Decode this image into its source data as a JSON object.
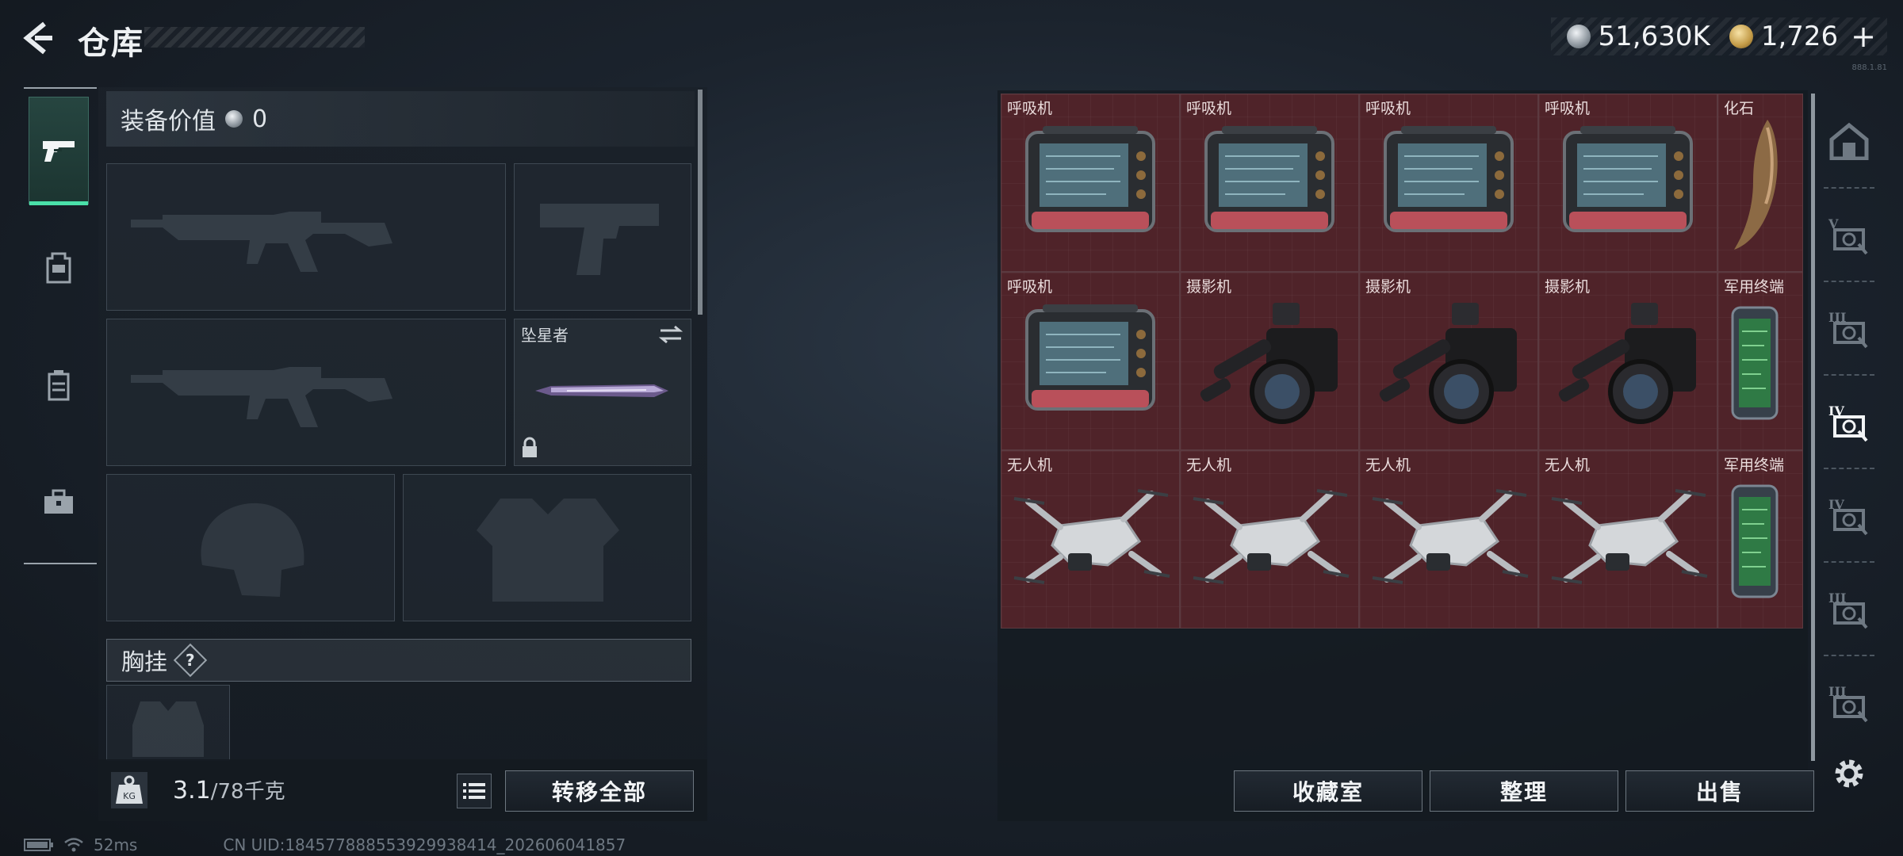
{
  "header": {
    "title": "仓库",
    "currencies": [
      {
        "icon": "silver-coin-icon",
        "value": "51,630K"
      },
      {
        "icon": "gold-coin-icon",
        "value": "1,726"
      }
    ],
    "add_symbol": "+",
    "tiny_text": "888.1.81"
  },
  "left_tabs": [
    {
      "name": "weapons",
      "icon": "pistol-icon",
      "active": true
    },
    {
      "name": "backpack",
      "icon": "backpack-icon",
      "active": false
    },
    {
      "name": "case",
      "icon": "container-icon",
      "active": false
    },
    {
      "name": "toolbox",
      "icon": "toolbox-icon",
      "active": false
    }
  ],
  "loadout": {
    "equip_value_label": "装备价值",
    "equip_value": "0",
    "melee_slot": {
      "label": "坠星者",
      "locked": true
    },
    "chest_rig_label": "胸挂",
    "help_symbol": "?",
    "weight_current": "3.1",
    "weight_max": "/78千克",
    "weight_icon_text": "KG",
    "transfer_all": "转移全部"
  },
  "stash": {
    "items": [
      {
        "name": "呼吸机",
        "icon": "ventilator"
      },
      {
        "name": "呼吸机",
        "icon": "ventilator"
      },
      {
        "name": "呼吸机",
        "icon": "ventilator"
      },
      {
        "name": "呼吸机",
        "icon": "ventilator"
      },
      {
        "name": "化石",
        "icon": "fossil-claw"
      },
      {
        "name": "呼吸机",
        "icon": "ventilator"
      },
      {
        "name": "摄影机",
        "icon": "video-camera"
      },
      {
        "name": "摄影机",
        "icon": "video-camera"
      },
      {
        "name": "摄影机",
        "icon": "video-camera"
      },
      {
        "name": "军用终端",
        "icon": "military-terminal"
      },
      {
        "name": "无人机",
        "icon": "drone"
      },
      {
        "name": "无人机",
        "icon": "drone"
      },
      {
        "name": "无人机",
        "icon": "drone"
      },
      {
        "name": "无人机",
        "icon": "drone"
      },
      {
        "name": "军用终端",
        "icon": "military-terminal"
      }
    ],
    "buttons": {
      "collection": "收藏室",
      "sort": "整理",
      "sell": "出售"
    }
  },
  "right_tabs": [
    {
      "name": "all",
      "icon": "house-icon",
      "active": false
    },
    {
      "name": "tier-v",
      "icon": "tier-v-icon",
      "roman": "V",
      "active": false
    },
    {
      "name": "tier-iii-a",
      "icon": "tier-iii-icon",
      "roman": "III",
      "active": false
    },
    {
      "name": "tier-iv-a",
      "icon": "tier-iv-icon",
      "roman": "IV",
      "active": true
    },
    {
      "name": "tier-iv-b",
      "icon": "tier-iv-icon",
      "roman": "IV",
      "active": false
    },
    {
      "name": "tier-iii-b",
      "icon": "tier-iii-icon",
      "roman": "III",
      "active": false
    },
    {
      "name": "tier-iii-c",
      "icon": "tier-iii-icon",
      "roman": "III",
      "active": false
    }
  ],
  "status": {
    "ping": "52ms",
    "uid": "CN UID:184577888553929938414_202606041857"
  }
}
